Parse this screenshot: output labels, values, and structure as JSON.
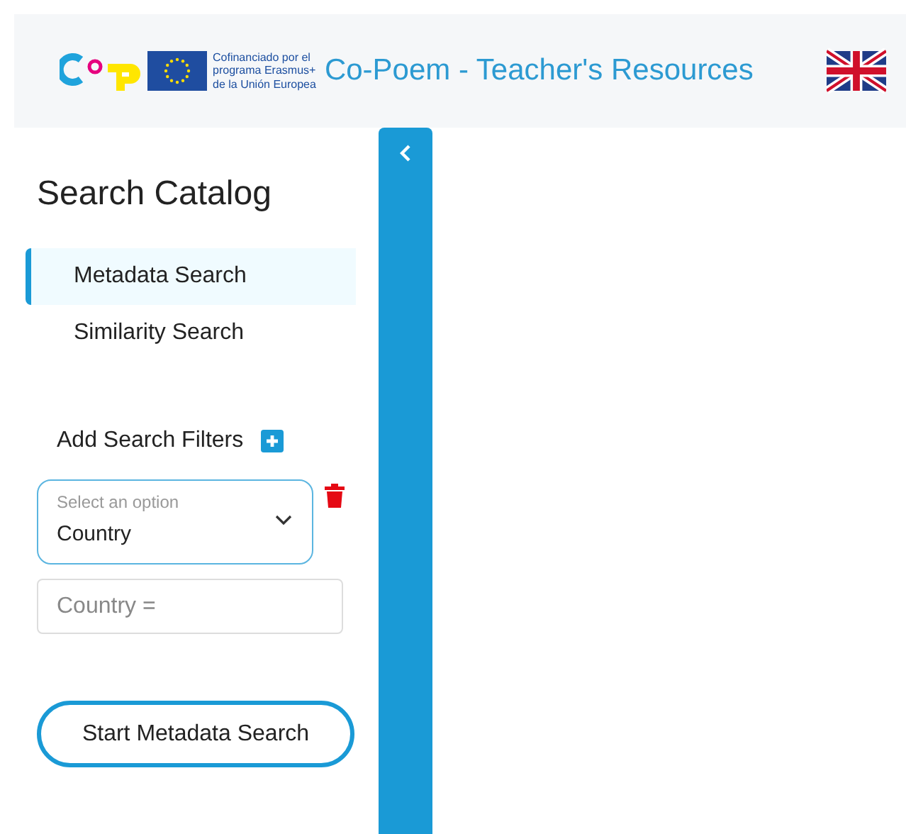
{
  "header": {
    "cofinancing_note": "Cofinanciado por el\nprograma Erasmus+\nde la Unión Europea",
    "title": "Co-Poem - Teacher's Resources"
  },
  "sidebar": {
    "title": "Search Catalog",
    "items": [
      {
        "label": "Metadata Search",
        "selected": true
      },
      {
        "label": "Similarity Search",
        "selected": false
      }
    ],
    "add_filters_label": "Add Search Filters",
    "filter": {
      "select_label": "Select an option",
      "select_value": "Country",
      "value_placeholder": "Country ="
    },
    "start_button": "Start Metadata Search"
  }
}
